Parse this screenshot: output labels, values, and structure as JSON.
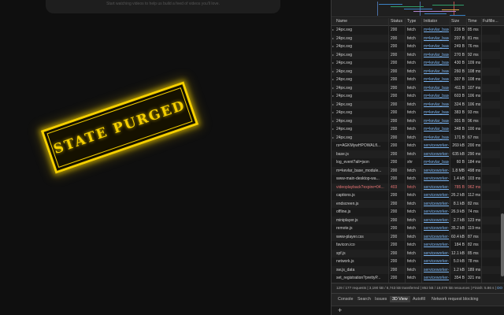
{
  "page": {
    "hint": "Start watching videos to help us build a feed of videos you'll love.",
    "stamp_text": "STATE PURGED"
  },
  "network": {
    "columns": [
      "Name",
      "Status",
      "Type",
      "Initiator",
      "Size",
      "Time",
      "Fulfille..."
    ],
    "rows": [
      {
        "name": "24px.svg",
        "status": "200",
        "type": "fetch",
        "initiator": "m=kevlar_base...",
        "size": "226 B",
        "time": "85 ms",
        "tri": true,
        "error": false
      },
      {
        "name": "24px.svg",
        "status": "200",
        "type": "fetch",
        "initiator": "m=kevlar_base...",
        "size": "207 B",
        "time": "81 ms",
        "tri": true,
        "error": false
      },
      {
        "name": "24px.svg",
        "status": "200",
        "type": "fetch",
        "initiator": "m=kevlar_base...",
        "size": "249 B",
        "time": "76 ms",
        "tri": true,
        "error": false
      },
      {
        "name": "24px.svg",
        "status": "200",
        "type": "fetch",
        "initiator": "m=kevlar_base...",
        "size": "270 B",
        "time": "92 ms",
        "tri": true,
        "error": false
      },
      {
        "name": "24px.svg",
        "status": "200",
        "type": "fetch",
        "initiator": "m=kevlar_base...",
        "size": "430 B",
        "time": "109 ms",
        "tri": true,
        "error": false
      },
      {
        "name": "24px.svg",
        "status": "200",
        "type": "fetch",
        "initiator": "m=kevlar_base...",
        "size": "260 B",
        "time": "108 ms",
        "tri": true,
        "error": false
      },
      {
        "name": "24px.svg",
        "status": "200",
        "type": "fetch",
        "initiator": "m=kevlar_base...",
        "size": "307 B",
        "time": "108 ms",
        "tri": true,
        "error": false
      },
      {
        "name": "24px.svg",
        "status": "200",
        "type": "fetch",
        "initiator": "m=kevlar_base...",
        "size": "411 B",
        "time": "107 ms",
        "tri": true,
        "error": false
      },
      {
        "name": "24px.svg",
        "status": "200",
        "type": "fetch",
        "initiator": "m=kevlar_base...",
        "size": "603 B",
        "time": "106 ms",
        "tri": true,
        "error": false
      },
      {
        "name": "24px.svg",
        "status": "200",
        "type": "fetch",
        "initiator": "m=kevlar_base...",
        "size": "324 B",
        "time": "106 ms",
        "tri": true,
        "error": false
      },
      {
        "name": "24px.svg",
        "status": "200",
        "type": "fetch",
        "initiator": "m=kevlar_base...",
        "size": "383 B",
        "time": "93 ms",
        "tri": true,
        "error": false
      },
      {
        "name": "24px.svg",
        "status": "200",
        "type": "fetch",
        "initiator": "m=kevlar_base...",
        "size": "301 B",
        "time": "96 ms",
        "tri": true,
        "error": false
      },
      {
        "name": "24px.svg",
        "status": "200",
        "type": "fetch",
        "initiator": "m=kevlar_base...",
        "size": "348 B",
        "time": "100 ms",
        "tri": true,
        "error": false
      },
      {
        "name": "24px.svg",
        "status": "200",
        "type": "fetch",
        "initiator": "m=kevlar_base...",
        "size": "171 B",
        "time": "67 ms",
        "tri": true,
        "error": false
      },
      {
        "name": "rs=AGKMywHPOWALfl...",
        "status": "200",
        "type": "fetch",
        "initiator": "serviceworker-k...",
        "size": "269 kB",
        "time": "200 ms",
        "tri": false,
        "error": false
      },
      {
        "name": "base.js",
        "status": "200",
        "type": "fetch",
        "initiator": "serviceworker-k...",
        "size": "635 kB",
        "time": "290 ms",
        "tri": false,
        "error": false
      },
      {
        "name": "log_event?alt=json",
        "status": "200",
        "type": "xhr",
        "initiator": "m=kevlar_base...",
        "size": "60 B",
        "time": "184 ms",
        "tri": false,
        "error": false
      },
      {
        "name": "m=kevlar_base_module...",
        "status": "200",
        "type": "fetch",
        "initiator": "serviceworker-k...",
        "size": "1.8 MB",
        "time": "498 ms",
        "tri": false,
        "error": false
      },
      {
        "name": "www-main-desktop-wa...",
        "status": "200",
        "type": "fetch",
        "initiator": "serviceworker-k...",
        "size": "1.4 kB",
        "time": "103 ms",
        "tri": false,
        "error": false
      },
      {
        "name": "videoplayback?expire=04...",
        "status": "403",
        "type": "fetch",
        "initiator": "serviceworker-k...",
        "size": "785 B",
        "time": "962 ms",
        "tri": false,
        "error": true
      },
      {
        "name": "captions.js",
        "status": "200",
        "type": "fetch",
        "initiator": "serviceworker-k...",
        "size": "26.2 kB",
        "time": "112 ms",
        "tri": false,
        "error": false
      },
      {
        "name": "endscreen.js",
        "status": "200",
        "type": "fetch",
        "initiator": "serviceworker-k...",
        "size": "8.1 kB",
        "time": "82 ms",
        "tri": false,
        "error": false
      },
      {
        "name": "offline.js",
        "status": "200",
        "type": "fetch",
        "initiator": "serviceworker-k...",
        "size": "26.9 kB",
        "time": "74 ms",
        "tri": false,
        "error": false
      },
      {
        "name": "miniplayer.js",
        "status": "200",
        "type": "fetch",
        "initiator": "serviceworker-k...",
        "size": "2.7 kB",
        "time": "123 ms",
        "tri": false,
        "error": false
      },
      {
        "name": "remote.js",
        "status": "200",
        "type": "fetch",
        "initiator": "serviceworker-k...",
        "size": "35.2 kB",
        "time": "119 ms",
        "tri": false,
        "error": false
      },
      {
        "name": "www-player.css",
        "status": "200",
        "type": "fetch",
        "initiator": "serviceworker-k...",
        "size": "60.4 kB",
        "time": "87 ms",
        "tri": false,
        "error": false
      },
      {
        "name": "favicon.ico",
        "status": "200",
        "type": "fetch",
        "initiator": "serviceworker-k...",
        "size": "184 B",
        "time": "82 ms",
        "tri": false,
        "error": false
      },
      {
        "name": "spf.js",
        "status": "200",
        "type": "fetch",
        "initiator": "serviceworker-k...",
        "size": "12.1 kB",
        "time": "85 ms",
        "tri": false,
        "error": false
      },
      {
        "name": "network.js",
        "status": "200",
        "type": "fetch",
        "initiator": "serviceworker-k...",
        "size": "5.0 kB",
        "time": "78 ms",
        "tri": false,
        "error": false
      },
      {
        "name": "sw.js_data",
        "status": "200",
        "type": "fetch",
        "initiator": "serviceworker-k...",
        "size": "1.2 kB",
        "time": "189 ms",
        "tri": false,
        "error": false
      },
      {
        "name": "set_registration?prettyP...",
        "status": "200",
        "type": "fetch",
        "initiator": "serviceworker-k...",
        "size": "354 B",
        "time": "321 ms",
        "tri": false,
        "error": false
      }
    ],
    "status_summary": "129 / 177 requests | 3,190 kB / 6,743 kB transferred | 852 kB / 18,079 kB resources | Finish: 5.86 s |",
    "status_link": "DO",
    "drawer_tabs": [
      "Console",
      "Search",
      "Issues",
      "3D View",
      "Autofill",
      "Network request blocking"
    ],
    "active_tab": "3D View",
    "add_label": "+"
  },
  "colors": {
    "stamp": "#f5d000",
    "link": "#7ab3ef",
    "error": "#e57373"
  }
}
